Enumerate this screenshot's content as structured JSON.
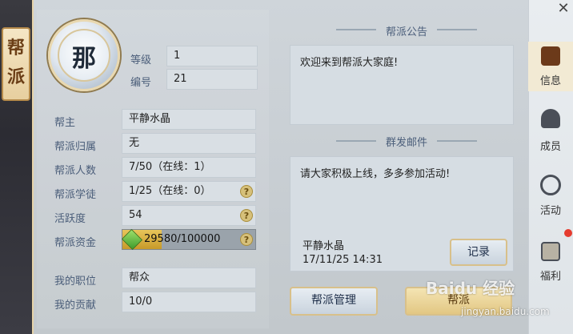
{
  "sidebar_title": [
    "帮",
    "派"
  ],
  "emblem_char": "那",
  "header": {
    "level_label": "等级",
    "level_value": "1",
    "id_label": "编号",
    "id_value": "21"
  },
  "info_rows": [
    {
      "label": "帮主",
      "value": "平静水晶"
    },
    {
      "label": "帮派归属",
      "value": "无"
    },
    {
      "label": "帮派人数",
      "value": "7/50（在线：1）"
    },
    {
      "label": "帮派学徒",
      "value": "1/25（在线：0）",
      "help": "?"
    },
    {
      "label": "活跃度",
      "value": "54",
      "help": "?"
    },
    {
      "label": "帮派资金",
      "value": "29580/100000",
      "help": "?",
      "progress": 0.2958
    }
  ],
  "member_rows": [
    {
      "label": "我的职位",
      "value": "帮众"
    },
    {
      "label": "我的贡献",
      "value": "10/0"
    }
  ],
  "announcement": {
    "title": "帮派公告",
    "text": "欢迎来到帮派大家庭!"
  },
  "mail": {
    "title": "群发邮件",
    "text": "请大家积极上线，多多参加活动!",
    "sender": "平静水晶",
    "time": "17/11/25 14:31",
    "record_button": "记录"
  },
  "buttons": {
    "manage": "帮派管理",
    "second": "帮派"
  },
  "tabs": [
    {
      "label": "信息",
      "icon": "info-icon"
    },
    {
      "label": "成员",
      "icon": "members-icon"
    },
    {
      "label": "活动",
      "icon": "activity-icon"
    },
    {
      "label": "福利",
      "icon": "gift-icon"
    }
  ],
  "close_symbol": "✕",
  "watermark": {
    "text": "Baidu 经验",
    "url": "jingyan.baidu.com"
  },
  "colors": {
    "accent_gold": "#d8c08a",
    "label_blue": "#4b5e7a",
    "progress": "#e2b94a",
    "badge_red": "#e53b2e"
  }
}
